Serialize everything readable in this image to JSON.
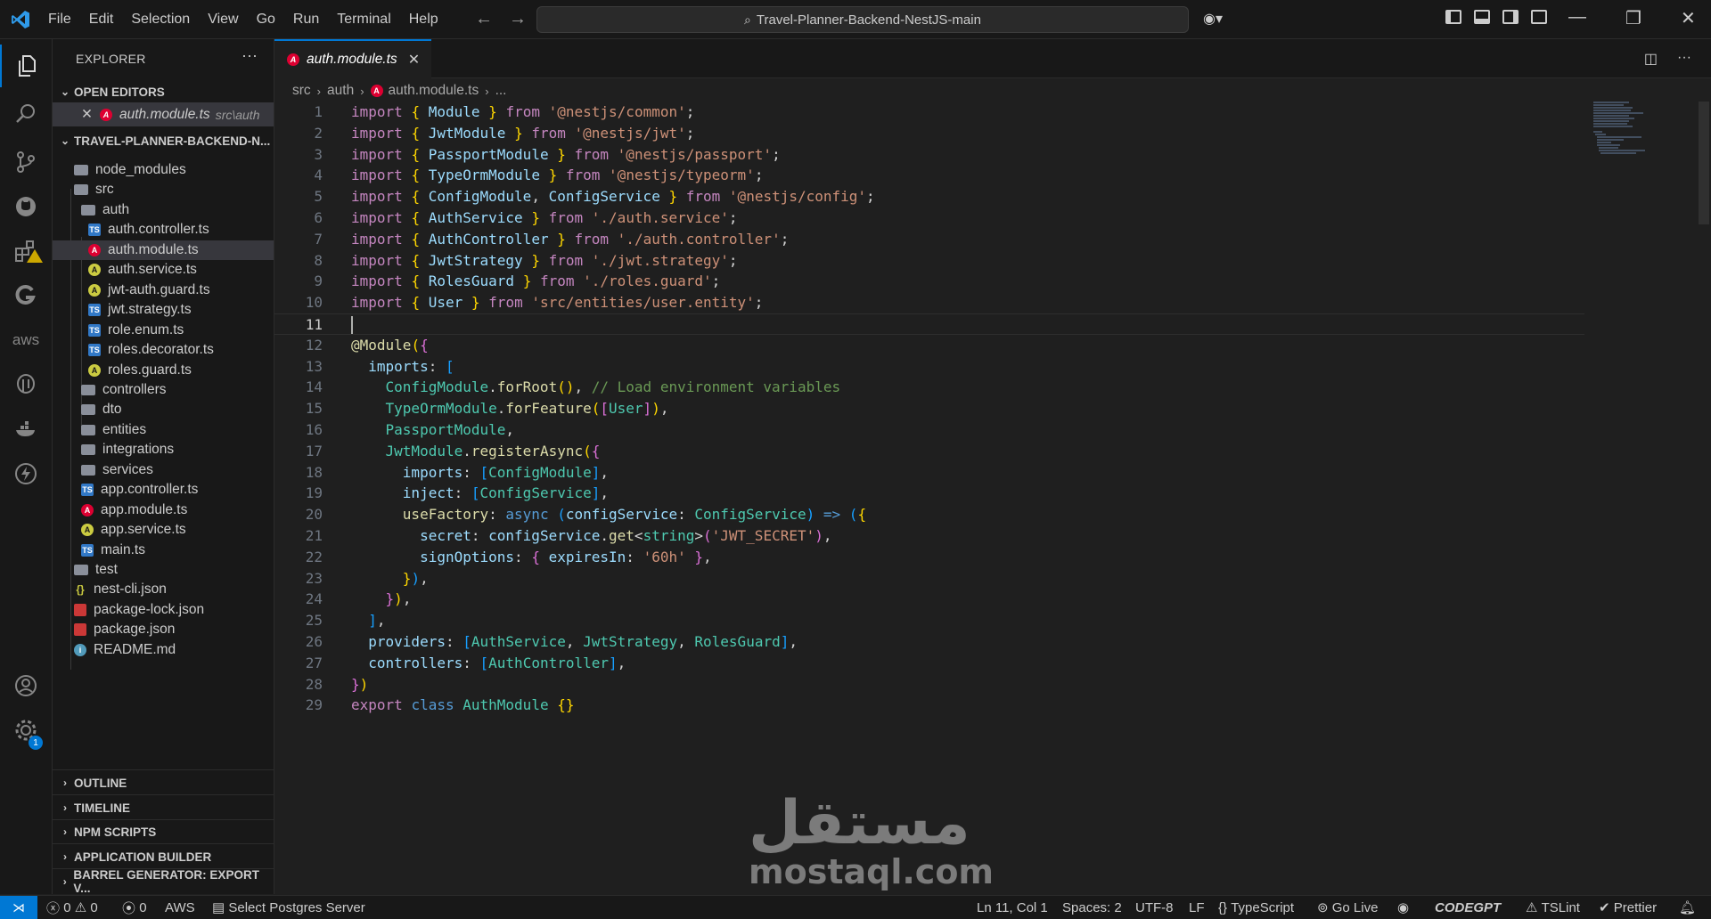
{
  "titlebar": {
    "menu": [
      "File",
      "Edit",
      "Selection",
      "View",
      "Go",
      "Run",
      "Terminal",
      "Help"
    ],
    "command_center": "Travel-Planner-Backend-NestJS-main"
  },
  "explorer": {
    "title": "EXPLORER",
    "open_editors_label": "OPEN EDITORS",
    "open_editor": {
      "name": "auth.module.ts",
      "path": "src\\auth"
    },
    "project_label": "TRAVEL-PLANNER-BACKEND-N...",
    "tree": [
      {
        "name": "node_modules",
        "icon": "folder"
      },
      {
        "name": "src",
        "icon": "folder-src"
      },
      {
        "name": "auth",
        "icon": "folder-open"
      },
      {
        "name": "auth.controller.ts",
        "icon": "ts"
      },
      {
        "name": "auth.module.ts",
        "icon": "angular-module"
      },
      {
        "name": "auth.service.ts",
        "icon": "angular-service"
      },
      {
        "name": "jwt-auth.guard.ts",
        "icon": "angular-guard"
      },
      {
        "name": "jwt.strategy.ts",
        "icon": "ts"
      },
      {
        "name": "role.enum.ts",
        "icon": "ts"
      },
      {
        "name": "roles.decorator.ts",
        "icon": "ts"
      },
      {
        "name": "roles.guard.ts",
        "icon": "angular-guard"
      },
      {
        "name": "controllers",
        "icon": "folder"
      },
      {
        "name": "dto",
        "icon": "folder"
      },
      {
        "name": "entities",
        "icon": "folder"
      },
      {
        "name": "integrations",
        "icon": "folder"
      },
      {
        "name": "services",
        "icon": "folder"
      },
      {
        "name": "app.controller.ts",
        "icon": "ts"
      },
      {
        "name": "app.module.ts",
        "icon": "angular-module"
      },
      {
        "name": "app.service.ts",
        "icon": "angular-service"
      },
      {
        "name": "main.ts",
        "icon": "ts"
      },
      {
        "name": "test",
        "icon": "folder-test"
      },
      {
        "name": "nest-cli.json",
        "icon": "json"
      },
      {
        "name": "package-lock.json",
        "icon": "npm"
      },
      {
        "name": "package.json",
        "icon": "npm"
      },
      {
        "name": "README.md",
        "icon": "info"
      }
    ],
    "bottom_sections": [
      "OUTLINE",
      "TIMELINE",
      "NPM SCRIPTS",
      "APPLICATION BUILDER",
      "BARREL GENERATOR: EXPORT V..."
    ]
  },
  "editor": {
    "tab_label": "auth.module.ts",
    "breadcrumb": [
      "src",
      "auth",
      "auth.module.ts",
      "..."
    ],
    "line_numbers": [
      "1",
      "2",
      "3",
      "4",
      "5",
      "6",
      "7",
      "8",
      "9",
      "10",
      "11",
      "12",
      "13",
      "14",
      "15",
      "16",
      "17",
      "18",
      "19",
      "20",
      "21",
      "22",
      "23",
      "24",
      "25",
      "26",
      "27",
      "28",
      "29"
    ],
    "cursor_line": "11"
  },
  "watermark": {
    "arabic": "مستقل",
    "latin": "mostaql.com"
  },
  "statusbar": {
    "errors": "0",
    "warnings": "0",
    "ports": "0",
    "aws": "AWS",
    "postgres": "Select Postgres Server",
    "position": "Ln 11, Col 1",
    "spaces": "Spaces: 2",
    "encoding": "UTF-8",
    "eol": "LF",
    "language": "TypeScript",
    "golive": "Go Live",
    "codegpt": "CODEGPT",
    "tslint": "TSLint",
    "prettier": "Prettier"
  },
  "colors": {
    "accent": "#0078d4",
    "background": "#1f1f1f",
    "sidebar": "#181818"
  }
}
